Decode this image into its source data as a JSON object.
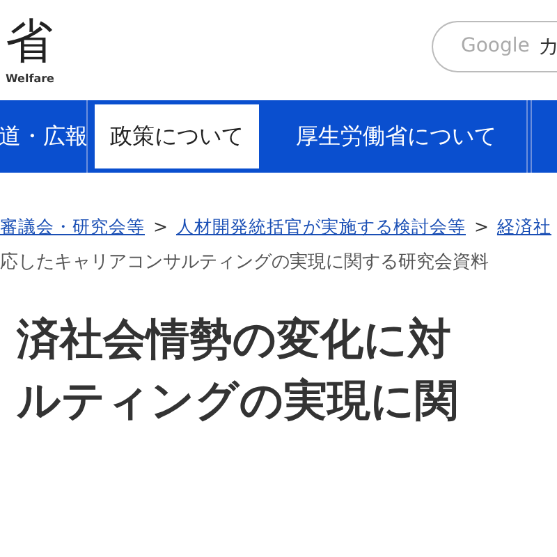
{
  "logo": {
    "mark": "省",
    "subtitle": "Welfare"
  },
  "search": {
    "placeholder": "Google",
    "button": "カ"
  },
  "nav": [
    {
      "label": "道・広報",
      "selected": false
    },
    {
      "label": "政策について",
      "selected": true
    },
    {
      "label": "厚生労働省について",
      "selected": false
    }
  ],
  "breadcrumb": {
    "links": [
      "審議会・研究会等",
      "人材開発統括官が実施する検討会等",
      "経済社"
    ],
    "separator": ">",
    "current": "応したキャリアコンサルティングの実現に関する研究会資料"
  },
  "heading": [
    "済社会情勢の変化に対",
    "ルティングの実現に関"
  ]
}
